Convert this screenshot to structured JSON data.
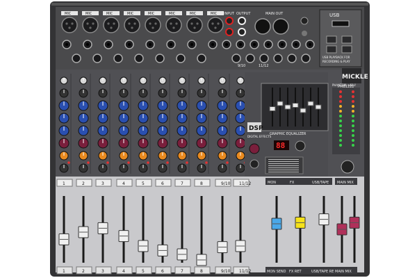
{
  "brand": "MICKLE",
  "model": "PMB1222",
  "header": {
    "mic_labels": [
      "MIC",
      "MIC",
      "MIC",
      "MIC",
      "MIC",
      "MIC",
      "MIC",
      "MIC"
    ],
    "input_label": "INPUT",
    "output_label": "OUTPUT",
    "main_out_label": "MAIN OUT",
    "usb_label": "USB",
    "usb_caption": "USB PLAYBACK FOR\nRECORDING & PLAY"
  },
  "jack_labels": [
    "9/10",
    "11/12"
  ],
  "dsp": {
    "logo": "DSP",
    "caption": "DIGITAL EFFECTS",
    "display_value": "88",
    "sub_label": "GRAPHIC EQUALIZER",
    "phantom_label": "PHANTOM +48 V"
  },
  "channel_labels": [
    "1",
    "2",
    "3",
    "4",
    "5",
    "6",
    "7",
    "8",
    "9/10",
    "11/12"
  ],
  "section_labels": {
    "mon": "MON",
    "fx": "FX",
    "usb_tape": "USB/TAPE",
    "main_mix": "MAIN MIX",
    "mon_send": "MON SEND",
    "fx_ret": "FX RET",
    "usb_tape_ret": "USB/TAPE RET",
    "main_mix_bottom": "MAIN MIX"
  },
  "colors": {
    "chassis": "#3a3a3c",
    "panel": "#4a4a4c",
    "fader_panel": "#cfcfd1",
    "knob_blue": "#2a4fb0",
    "knob_maroon": "#7a1f3c",
    "knob_orange": "#e98a1f",
    "fader_white": "#f0f0f0",
    "fader_blue": "#4aa8e8",
    "fader_yellow": "#f6e21a",
    "fader_red": "#b0305a",
    "led_green": "#37d34a",
    "led_red": "#e63232",
    "display_red": "#ff2a2a"
  },
  "fader_levels": [
    0.42,
    0.55,
    0.62,
    0.48,
    0.3,
    0.22,
    0.15,
    0.05,
    0.28,
    0.3,
    0.7,
    0.72,
    0.78,
    0.6
  ]
}
